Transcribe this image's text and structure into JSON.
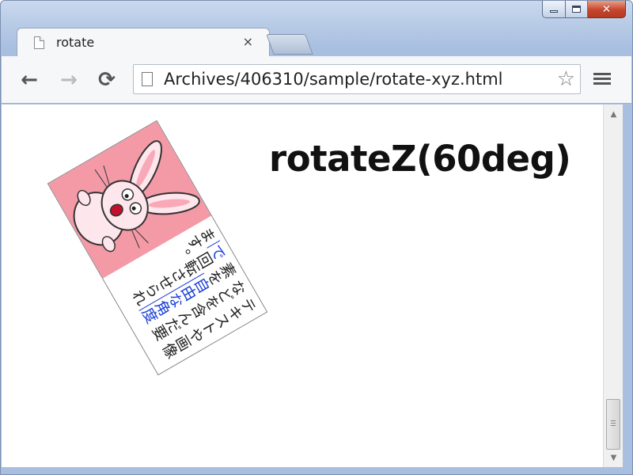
{
  "tab": {
    "title": "rotate",
    "close": "×"
  },
  "toolbar": {
    "back": "←",
    "forward": "→",
    "reload": "⟳",
    "star": "☆"
  },
  "address": {
    "url": "Archives/406310/sample/rotate-xyz.html"
  },
  "content": {
    "heading": "rotateZ(60deg)",
    "text_before": "テキストや画像などを含んだ要素を",
    "link_text": "自由な角度で",
    "text_after": "回転させられます。"
  },
  "window_controls": {
    "close": "✕"
  },
  "icons": {
    "tab": "page-icon",
    "back": "back-arrow-icon",
    "forward": "forward-arrow-icon",
    "reload": "reload-icon",
    "star": "star-icon",
    "menu": "hamburger-menu-icon",
    "bunny": "bunny-illustration"
  },
  "colors": {
    "bunny_bg": "#f49aa7",
    "link": "#1a3fd8"
  }
}
